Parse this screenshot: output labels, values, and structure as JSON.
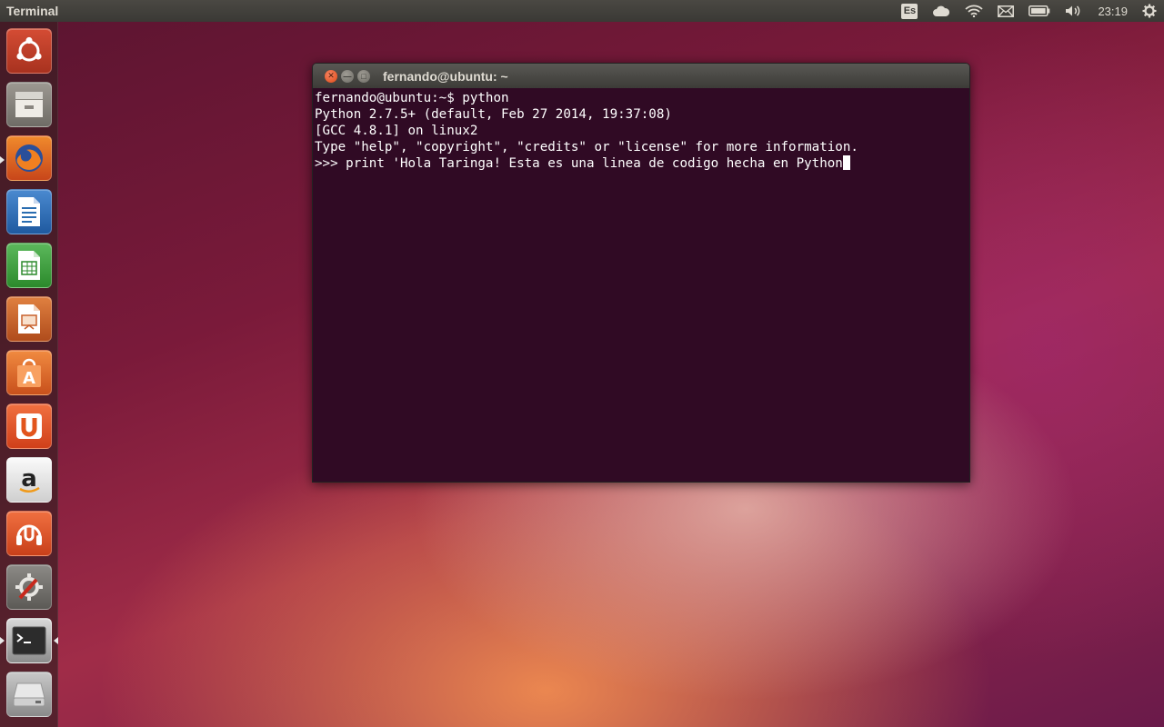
{
  "top_panel": {
    "app_title": "Terminal",
    "keyboard_layout": "Es",
    "clock": "23:19",
    "icons": [
      "keyboard-layout-icon",
      "cloud-icon",
      "wifi-icon",
      "mail-icon",
      "battery-icon",
      "volume-icon",
      "gear-icon"
    ]
  },
  "launcher": {
    "items": [
      {
        "name": "ubuntu-dash",
        "icon": "ubuntu-logo-icon",
        "color": "#c7412c"
      },
      {
        "name": "files",
        "icon": "file-cabinet-icon",
        "color": "#8a8680"
      },
      {
        "name": "firefox",
        "icon": "firefox-icon",
        "color": "#e66b1f"
      },
      {
        "name": "libreoffice-writer",
        "icon": "writer-document-icon",
        "color": "#2a6db0"
      },
      {
        "name": "libreoffice-calc",
        "icon": "calc-spreadsheet-icon",
        "color": "#3a9a3a"
      },
      {
        "name": "libreoffice-impress",
        "icon": "impress-presentation-icon",
        "color": "#c8602c"
      },
      {
        "name": "software-center",
        "icon": "shopping-bag-icon",
        "color": "#e06a2a"
      },
      {
        "name": "ubuntu-one",
        "icon": "ubuntu-one-icon",
        "color": "#e2541c"
      },
      {
        "name": "amazon",
        "icon": "amazon-icon",
        "color": "#e6e6e6"
      },
      {
        "name": "ubuntu-one-music",
        "icon": "headphones-icon",
        "color": "#d8501e"
      },
      {
        "name": "system-settings",
        "icon": "wrench-gear-icon",
        "color": "#7a7874"
      },
      {
        "name": "terminal",
        "icon": "terminal-icon",
        "color": "#4a4a4a"
      },
      {
        "name": "removable-drive",
        "icon": "drive-icon",
        "color": "#b8b8b8"
      }
    ]
  },
  "terminal": {
    "title": "fernando@ubuntu: ~",
    "lines": [
      "fernando@ubuntu:~$ python",
      "Python 2.7.5+ (default, Feb 27 2014, 19:37:08)",
      "[GCC 4.8.1] on linux2",
      "Type \"help\", \"copyright\", \"credits\" or \"license\" for more information.",
      ">>> print 'Hola Taringa! Esta es una linea de codigo hecha en Python"
    ],
    "cursor_char": "'",
    "colors": {
      "background": "#300a24",
      "text": "#ffffff"
    }
  }
}
